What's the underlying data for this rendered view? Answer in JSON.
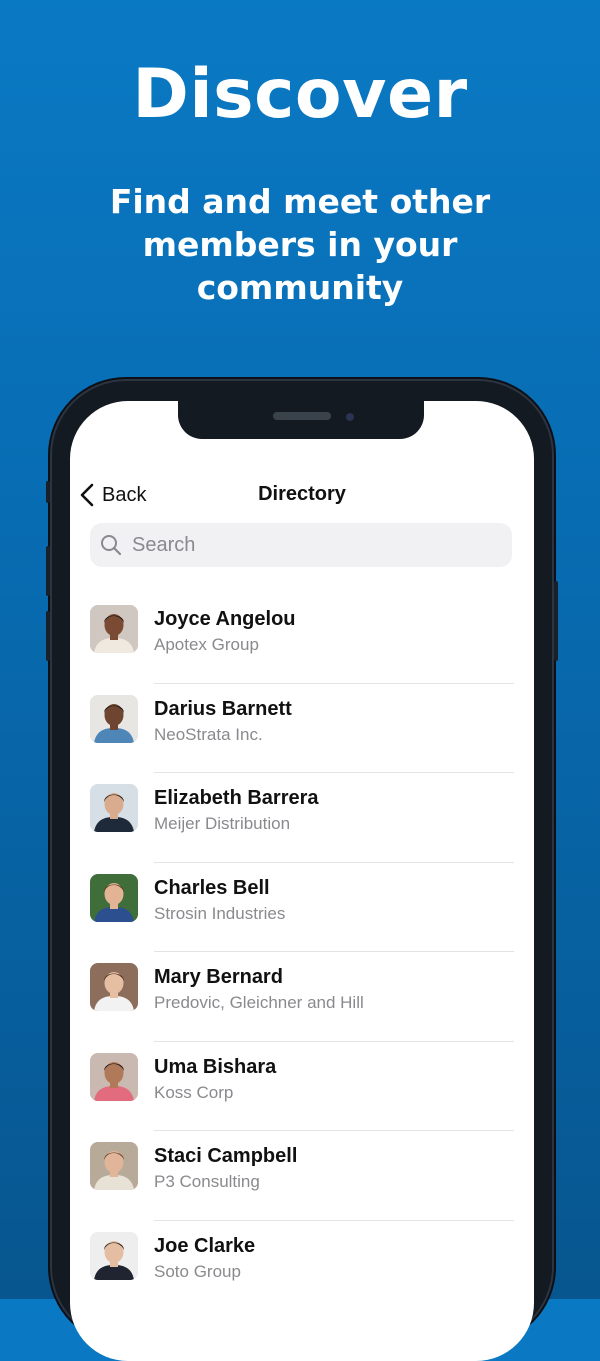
{
  "promo": {
    "headline": "Discover",
    "subheadline": "Find and meet other members in your community"
  },
  "app": {
    "nav": {
      "back_label": "Back",
      "title": "Directory"
    },
    "search": {
      "placeholder": "Search"
    },
    "members": [
      {
        "name": "Joyce Angelou",
        "company": "Apotex Group",
        "avatar": {
          "skin": "#7a4b32",
          "hair": "#1b1412",
          "bg": "#cfc7c0",
          "shirt": "#efe9e0"
        }
      },
      {
        "name": "Darius Barnett",
        "company": "NeoStrata Inc.",
        "avatar": {
          "skin": "#6e4530",
          "hair": "#1a1410",
          "bg": "#e8e6e3",
          "shirt": "#4f86b8"
        }
      },
      {
        "name": "Elizabeth Barrera",
        "company": "Meijer Distribution",
        "avatar": {
          "skin": "#d9ab8f",
          "hair": "#2a1c16",
          "bg": "#d7dfe6",
          "shirt": "#1e2a3a"
        }
      },
      {
        "name": "Charles Bell",
        "company": "Strosin Industries",
        "avatar": {
          "skin": "#e2b394",
          "hair": "#5a3b24",
          "bg": "#3f6e3a",
          "shirt": "#2b4f8f"
        }
      },
      {
        "name": "Mary Bernard",
        "company": "Predovic, Gleichner and Hill",
        "avatar": {
          "skin": "#e6bfa2",
          "hair": "#4a2e1f",
          "bg": "#8d6e5c",
          "shirt": "#f2f2f2"
        }
      },
      {
        "name": "Uma Bishara",
        "company": "Koss Corp",
        "avatar": {
          "skin": "#b07a5a",
          "hair": "#1c1410",
          "bg": "#c9b9b0",
          "shirt": "#e36b7e"
        }
      },
      {
        "name": "Staci Campbell",
        "company": "P3 Consulting",
        "avatar": {
          "skin": "#e0b59a",
          "hair": "#6b4529",
          "bg": "#b8aa98",
          "shirt": "#e8e1d6"
        }
      },
      {
        "name": "Joe Clarke",
        "company": "Soto Group",
        "avatar": {
          "skin": "#e4bda2",
          "hair": "#2b1e17",
          "bg": "#eeeeee",
          "shirt": "#1f2430"
        }
      }
    ]
  },
  "colors": {
    "background_top": "#0a79c4",
    "background_bottom": "#07568f",
    "phone_frame": "#141a22",
    "secondary_text": "#8a8a8e"
  }
}
